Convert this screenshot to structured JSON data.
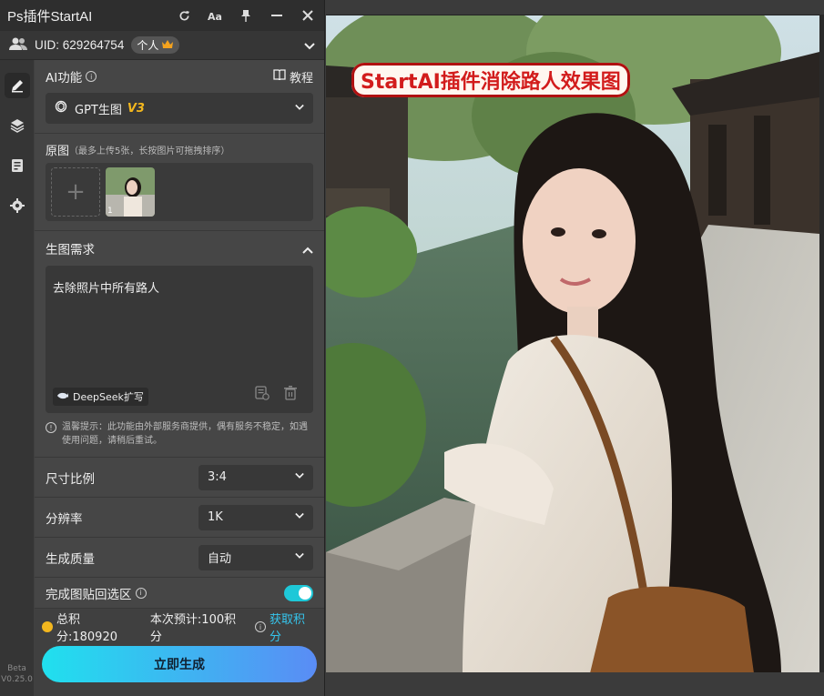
{
  "app": {
    "title": "Ps插件StartAI"
  },
  "titlebar": {
    "icons": [
      "refresh-icon",
      "font-size-icon",
      "pin-icon",
      "minimize-icon",
      "close-icon"
    ]
  },
  "user": {
    "uid_label": "UID: 629264754",
    "plan_badge": "个人"
  },
  "ai_function": {
    "label": "AI功能",
    "tutorial": "教程",
    "selected": "GPT生图",
    "version_tag": "V3"
  },
  "source": {
    "label": "原图",
    "hint": "（最多上传5张，长按图片可拖拽排序）",
    "add_symbol": "+",
    "thumb_index": "1"
  },
  "prompt": {
    "label": "生图需求",
    "text": "去除照片中所有路人",
    "deepseek_label": "DeepSeek扩写"
  },
  "notice": {
    "text": "温馨提示：此功能由外部服务商提供，偶有服务不稳定，如遇使用问题，请稍后重试。"
  },
  "options": {
    "aspect_label": "尺寸比例",
    "aspect_value": "3:4",
    "resolution_label": "分辨率",
    "resolution_value": "1K",
    "quality_label": "生成质量",
    "quality_value": "自动",
    "paste_label": "完成图贴回选区",
    "paste_on": true
  },
  "footer": {
    "total_points": "总积分:180920",
    "estimate": "本次预计:100积分",
    "get_points": "获取积分",
    "generate": "立即生成"
  },
  "version": {
    "stage": "Beta",
    "number": "V0.25.0"
  },
  "canvas": {
    "banner": "StartAI插件消除路人效果图"
  },
  "colors": {
    "accent_cyan": "#20e0ee",
    "accent_blue": "#5a8cf5",
    "link": "#35c6ee",
    "banner_red": "#d21c1c",
    "tag_gold": "#f3b71e"
  }
}
